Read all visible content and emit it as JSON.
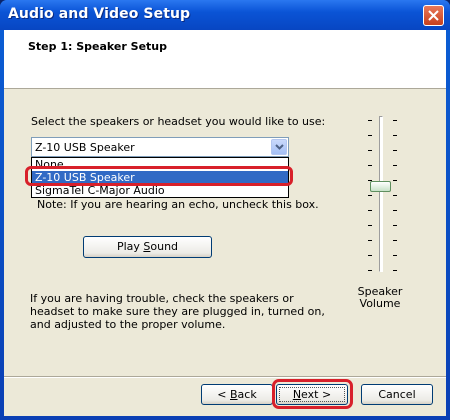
{
  "window": {
    "title": "Audio and Video Setup"
  },
  "header": {
    "step_title": "Step 1: Speaker Setup"
  },
  "speakers": {
    "label": "Select the speakers or headset you would like to use:",
    "selected": "Z-10 USB Speaker",
    "options": [
      "None",
      "Z-10 USB Speaker",
      "SigmaTel C-Major Audio"
    ]
  },
  "note": "Note: If you are hearing an echo, uncheck this box.",
  "play_sound": {
    "pre": "Play ",
    "accel": "S",
    "post": "ound"
  },
  "trouble_text": "If you are having trouble, check the speakers or headset to make sure they are plugged in, turned on, and adjusted to the proper volume.",
  "volume": {
    "label": "Speaker Volume",
    "level": 0.55
  },
  "buttons": {
    "back": {
      "pre": "< ",
      "accel": "B",
      "post": "ack"
    },
    "next": {
      "pre": "",
      "accel": "N",
      "post": "ext >"
    },
    "cancel": "Cancel"
  },
  "colors": {
    "title_bar": "#0a54d6",
    "selection": "#316ac5",
    "highlight_ring": "#d8202a"
  }
}
